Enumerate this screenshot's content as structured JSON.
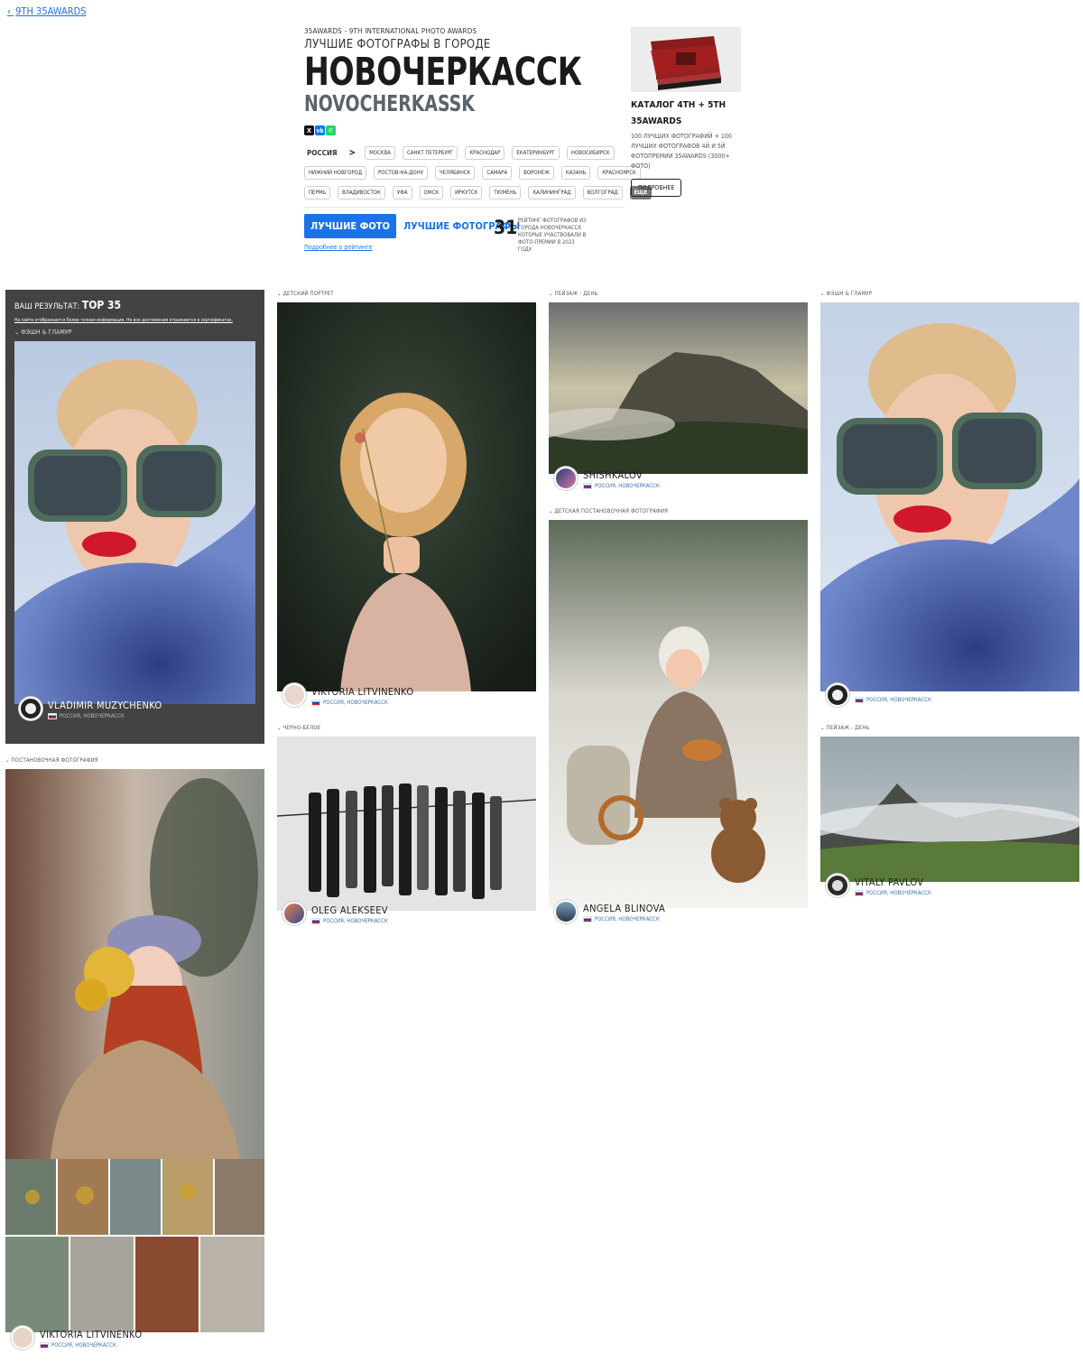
{
  "back_link": "9TH 35AWARDS",
  "header": {
    "pre_title": "35AWARDS - 9TH INTERNATIONAL PHOTO AWARDS",
    "subtitle": "ЛУЧШИЕ ФОТОГРАФЫ В ГОРОДЕ",
    "title": "НОВОЧЕРКАССК",
    "title_latin": "NOVOCHERKASSK"
  },
  "share_icons": [
    "x-icon",
    "vk-icon",
    "whatsapp-icon"
  ],
  "country": "РОССИЯ",
  "separator": ">",
  "city_rows": [
    [
      "МОСКВА",
      "САНКТ ПЕТЕРБУРГ",
      "КРАСНОДАР",
      "ЕКАТЕРИНБУРГ",
      "НОВОСИБИРСК"
    ],
    [
      "НИЖНИЙ НОВГОРОД",
      "РОСТОВ-НА-ДОНУ",
      "ЧЕЛЯБИНСК",
      "САМАРА",
      "ВОРОНЕЖ",
      "КАЗАНЬ",
      "КРАСНОЯРСК"
    ],
    [
      "ПЕРМЬ",
      "ВЛАДИВОСТОК",
      "УФА",
      "ОМСК",
      "ИРКУТСК",
      "ТЮМЕНЬ",
      "КАЛИНИНГРАД",
      "ВОЛГОГРАД"
    ]
  ],
  "more_label": "ЕЩЕ",
  "tabs": {
    "active": "ЛУЧШИЕ ФОТО",
    "other": "ЛУЧШИЕ ФОТОГРАФЫ"
  },
  "rating_link": "Подробнее о рейтинге",
  "rank": {
    "number": "31",
    "text": "РЕЙТИНГ ФОТОГРАФОВ ИЗ ГОРОДА НОВОЧЕРКАССК КОТОРЫЕ УЧАСТВОВАЛИ В ФОТО-ПРЕМИИ В 2023 ГОДУ"
  },
  "catalog": {
    "title": "КАТАЛОГ 4TH + 5TH 35AWARDS",
    "description": "100 ЛУЧШИХ ФОТОГРАФИЙ + 100 ЛУЧШИХ ФОТОГРАФОВ 4Й И 5Й ФОТОПРЕМИИ 35AWARDS (3000+ ФОТО)",
    "button": "ПОДРОБНЕЕ"
  },
  "result_box": {
    "label": "ВАШ РЕЗУЛЬТАТ:",
    "value": "TOP 35",
    "note": "На сайте отображается более точная информация. Не все достижения отражаются в сертификатах.",
    "category": "ФЭШН & ГЛАМУР",
    "author": "VLADIMIR MUZYCHENKO",
    "location": "РОССИЯ, НОВОЧЕРКАССК"
  },
  "cards": {
    "child_portrait": {
      "category": "ДЕТСКИЙ ПОРТРЕТ",
      "author": "VIKTORIA LITVINENKO",
      "location": "РОССИЯ, НОВОЧЕРКАССК"
    },
    "landscape_1": {
      "category": "ПЕЙЗАЖ - ДЕНЬ",
      "author": "SHISHKALOV",
      "location": "РОССИЯ, НОВОЧЕРКАССК"
    },
    "fashion": {
      "category": "ФЭШН & ГЛАМУР",
      "author": "",
      "location": "РОССИЯ, НОВОЧЕРКАССК"
    },
    "kids_staged": {
      "category": "ДЕТСКАЯ ПОСТАНОВОЧНАЯ ФОТОГРАФИЯ",
      "author": "ANGELA BLINOVA",
      "location": "РОССИЯ, НОВОЧЕРКАССК"
    },
    "black_white": {
      "category": "ЧЕРНО-БЕЛОЕ",
      "author": "OLEG ALEKSEEV",
      "location": "РОССИЯ, НОВОЧЕРКАССК"
    },
    "landscape_2": {
      "category": "ПЕЙЗАЖ - ДЕНЬ",
      "author": "VITALY PAVLOV",
      "location": "РОССИЯ, НОВОЧЕРКАССК"
    },
    "staged": {
      "category": "ПОСТАНОВОЧНАЯ ФОТОГРАФИЯ",
      "author": "VIKTORIA LITVINENKO",
      "location": "РОССИЯ, НОВОЧЕРКАССК"
    }
  },
  "colors": {
    "accent": "#1a73e8",
    "dark_panel": "#434343"
  }
}
